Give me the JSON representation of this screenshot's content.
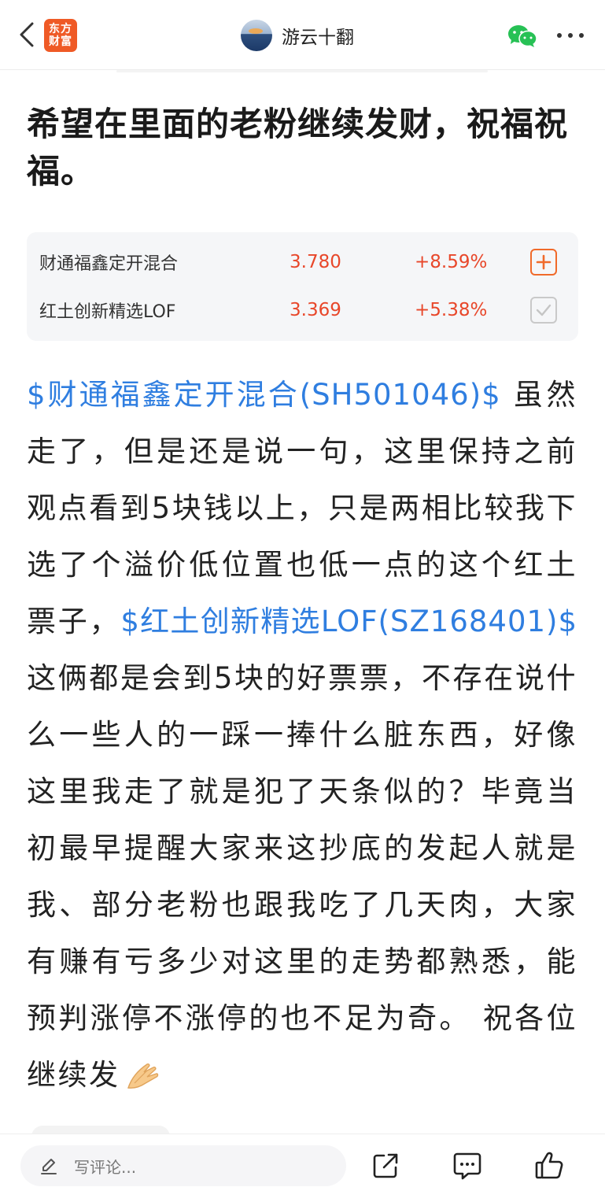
{
  "header": {
    "logo_line1": "东方",
    "logo_line2": "财富",
    "author_name": "游云十翻"
  },
  "post": {
    "title": "希望在里面的老粉继续发财，祝福祝福。",
    "segments": {
      "link1": "$财通福鑫定开混合(SH501046)$",
      "text1": " 虽然走了，但是还是说一句，这里保持之前观点看到5块钱以上，只是两相比较我下选了个溢价低位置也低一点的这个红土票子，",
      "link2": "$红土创新精选LOF(SZ168401)$",
      "text2": " 这俩都是会到5块的好票票，不存在说什么一些人的一踩一捧什么脏东西，好像这里我走了就是犯了天条似的？毕竟当初最早提醒大家来这抄底的发起人就是我、部分老粉也跟我吃了几天肉，大家有赚有亏多少对这里的走势都熟悉，能预判涨停不涨停的也不足为奇。 祝各位继续发"
    }
  },
  "funds": [
    {
      "name": "财通福鑫定开混合",
      "price": "3.780",
      "change": "+8.59%",
      "watch_state": "add"
    },
    {
      "name": "红土创新精选LOF",
      "price": "3.369",
      "change": "+5.38%",
      "watch_state": "added"
    }
  ],
  "bottom": {
    "comment_placeholder": "写评论..."
  },
  "colors": {
    "brand": "#ef5a26",
    "link": "#2f7ee0",
    "up": "#e8472a"
  },
  "icons": [
    "back-icon",
    "wechat-icon",
    "more-icon",
    "pray-hands-emoji",
    "pen-icon",
    "share-icon",
    "comment-icon",
    "like-icon"
  ]
}
